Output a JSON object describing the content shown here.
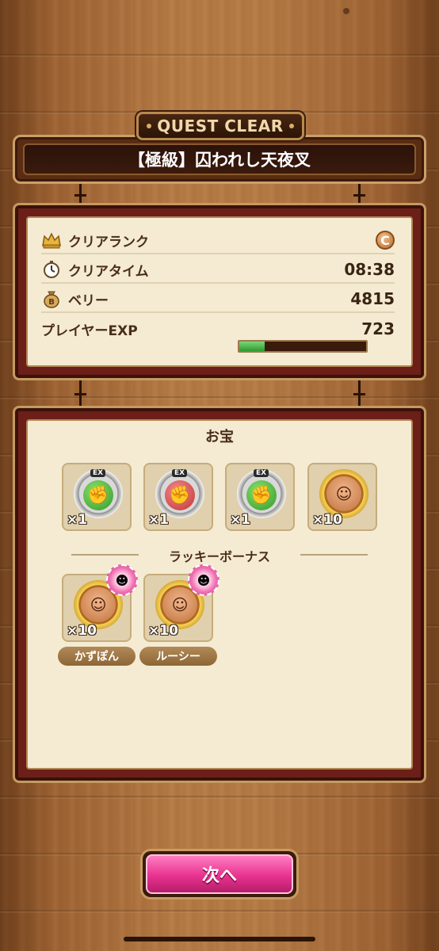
{
  "header": {
    "badge": "QUEST CLEAR",
    "quest_title": "【極級】囚われし天夜叉"
  },
  "stats": {
    "rank_label": "クリアランク",
    "rank_value": "C",
    "time_label": "クリアタイム",
    "time_value": "08:38",
    "berry_label": "ベリー",
    "berry_value": "4815",
    "exp_label": "プレイヤーEXP",
    "exp_value": "723",
    "exp_progress": 0.2
  },
  "treasure": {
    "title": "お宝",
    "items": [
      {
        "icon": "green-fist-ex-medal",
        "ex": "EX",
        "qty": "×1"
      },
      {
        "icon": "red-fist-ex-medal",
        "ex": "EX",
        "qty": "×1"
      },
      {
        "icon": "green-fist-ex-medal",
        "ex": "EX",
        "qty": "×1"
      },
      {
        "icon": "character-gold-medal",
        "qty": "×10"
      }
    ],
    "bonus_title": "ラッキーボーナス",
    "bonus": [
      {
        "icon": "character-gold-medal",
        "qty": "×10",
        "owner": "かずぽん"
      },
      {
        "icon": "character-gold-medal",
        "qty": "×10",
        "owner": "ルーシー"
      }
    ]
  },
  "next_button": "次へ",
  "colors": {
    "accent": "#e8328f",
    "panel": "#f4ebd2",
    "frame": "#6b1f18",
    "exp_fill": "#2e9a2e"
  }
}
